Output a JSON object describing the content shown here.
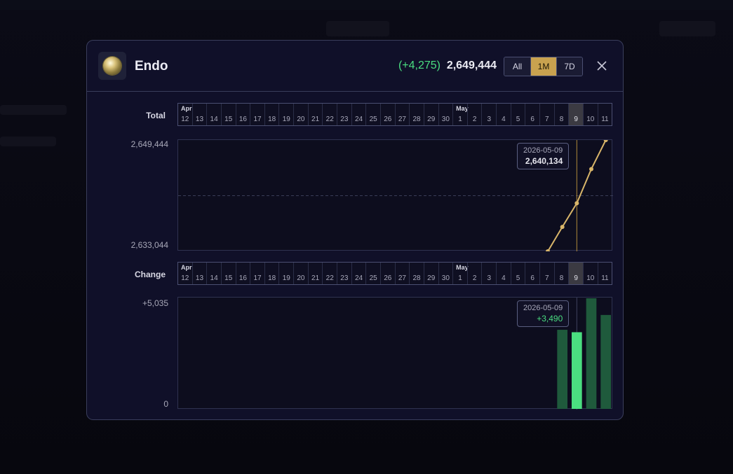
{
  "modal": {
    "title": "Endo",
    "delta": "(+4,275)",
    "total": "2,649,444",
    "ranges": [
      "All",
      "1M",
      "7D"
    ],
    "active_range": "1M"
  },
  "total_row": {
    "label": "Total",
    "y_max_label": "2,649,444",
    "y_min_label": "2,633,044",
    "tooltip": {
      "date": "2026-05-09",
      "value": "2,640,134"
    }
  },
  "change_row": {
    "label": "Change",
    "y_max_label": "+5,035",
    "y_min_label": "0",
    "tooltip": {
      "date": "2026-05-09",
      "value": "+3,490"
    }
  },
  "timeline": {
    "days": [
      "12",
      "13",
      "14",
      "15",
      "16",
      "17",
      "18",
      "19",
      "20",
      "21",
      "22",
      "23",
      "24",
      "25",
      "26",
      "27",
      "28",
      "29",
      "30",
      "1",
      "2",
      "3",
      "4",
      "5",
      "6",
      "7",
      "8",
      "9",
      "10",
      "11"
    ],
    "months": [
      {
        "label": "Apr",
        "index": 0
      },
      {
        "label": "May",
        "index": 19
      }
    ],
    "selected_index": 27
  },
  "chart_data": [
    {
      "type": "line",
      "x": [
        "2026-05-07",
        "2026-05-08",
        "2026-05-09",
        "2026-05-10",
        "2026-05-11"
      ],
      "y": [
        2633044,
        2636644,
        2640134,
        2645169,
        2649444
      ],
      "ylim": [
        2633044,
        2649444
      ],
      "grid": "midline dashed",
      "color": "#d8b56a"
    },
    {
      "type": "bar",
      "x": [
        "2026-05-08",
        "2026-05-09",
        "2026-05-10",
        "2026-05-11"
      ],
      "y": [
        3600,
        3490,
        5035,
        4275
      ],
      "ylim": [
        0,
        5035
      ],
      "highlight": "2026-05-09",
      "color": "#1f5a3c",
      "highlight_color": "#4ade80"
    }
  ]
}
